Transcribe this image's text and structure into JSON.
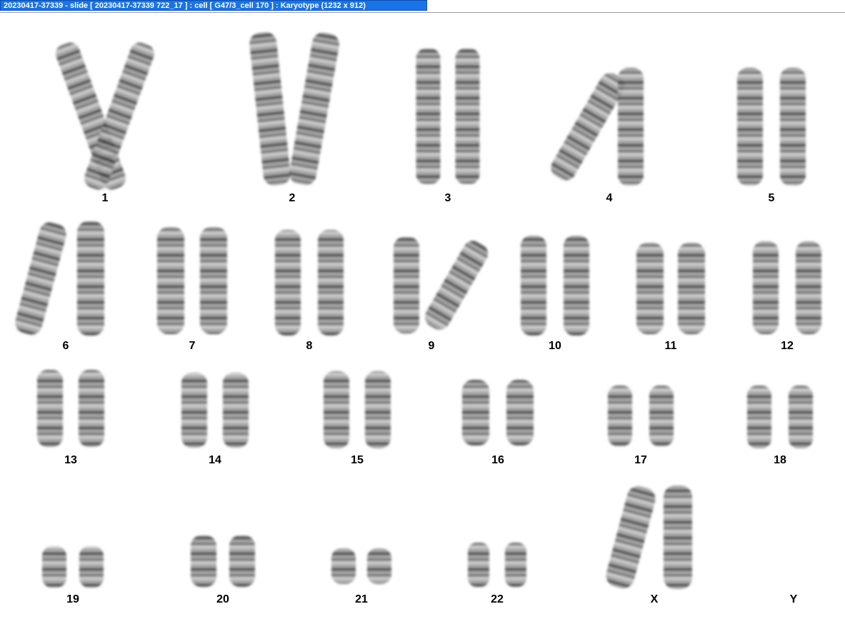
{
  "window": {
    "title": "20230417-37339 - slide [ 20230417-37339 722_17 ] : cell [ G47/3_cell 170 ] : Karyotype  (1232 x 912)"
  },
  "karyotype": {
    "chromosomes": [
      {
        "label": "1"
      },
      {
        "label": "2"
      },
      {
        "label": "3"
      },
      {
        "label": "4"
      },
      {
        "label": "5"
      },
      {
        "label": "6"
      },
      {
        "label": "7"
      },
      {
        "label": "8"
      },
      {
        "label": "9"
      },
      {
        "label": "10"
      },
      {
        "label": "11"
      },
      {
        "label": "12"
      },
      {
        "label": "13"
      },
      {
        "label": "14"
      },
      {
        "label": "15"
      },
      {
        "label": "16"
      },
      {
        "label": "17"
      },
      {
        "label": "18"
      },
      {
        "label": "19"
      },
      {
        "label": "20"
      },
      {
        "label": "21"
      },
      {
        "label": "22"
      },
      {
        "label": "X"
      },
      {
        "label": "Y"
      }
    ]
  }
}
